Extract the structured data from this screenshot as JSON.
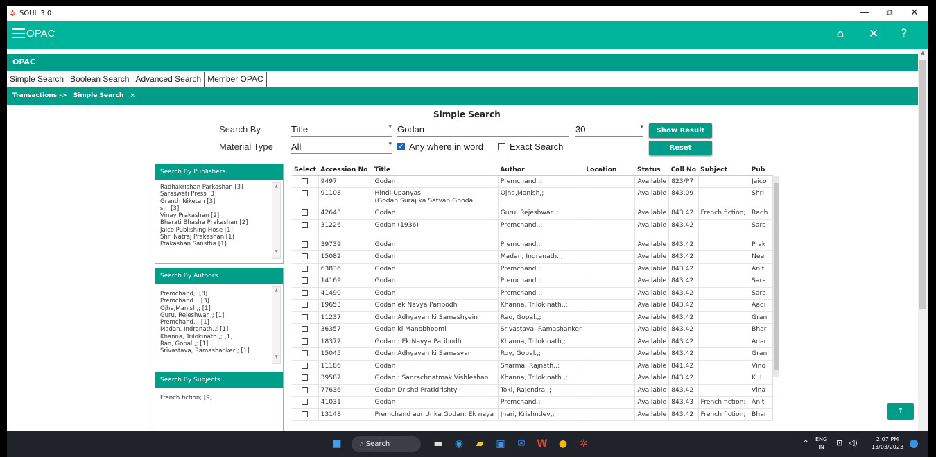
{
  "window": {
    "title": "SOUL 3.0",
    "controls": [
      "—",
      "⧉",
      "✕"
    ]
  },
  "header": {
    "app_name": "OPAC"
  },
  "opac_bar": "OPAC",
  "tabs": [
    "Simple Search",
    "Boolean Search",
    "Advanced Search",
    "Member OPAC"
  ],
  "breadcrumb": {
    "parent": "Transactions ->",
    "current": "Simple Search",
    "close": "×"
  },
  "form": {
    "title": "Simple Search",
    "search_by_label": "Search By",
    "search_by_value": "Title",
    "query": "Godan",
    "page_size": "30",
    "material_type_label": "Material Type",
    "material_type_value": "All",
    "anywhere_label": "Any where in word",
    "anywhere_checked": true,
    "exact_label": "Exact Search",
    "exact_checked": false,
    "show_result": "Show Result",
    "reset": "Reset"
  },
  "panels": {
    "publishers": {
      "title": "Search By Publishers",
      "items": [
        "Radhakrishan Parkashan [3]",
        "Saraswati Press [3]",
        "Granth Niketan [3]",
        "s.n [3]",
        "Vinay Prakashan [2]",
        "Bharati Bhasha Prakashan [2]",
        "Jaico Publishing Hose [1]",
        "Shri Natraj Prakashan [1]",
        "Prakashan Sanstha [1]"
      ]
    },
    "authors": {
      "title": "Search By Authors",
      "items": [
        "Premchand,; [8]",
        "Premchand ,; [3]",
        "Ojha,Manish,; [1]",
        "Guru, Rejeshwar.,; [1]",
        "Premchand.,; [1]",
        "Madan, Indranath.,; [1]",
        "Khanna, Trilokinath.,; [1]",
        "Rao, Gopal.,; [1]",
        "Srivastava, Ramashanker ; [1]"
      ]
    },
    "subjects": {
      "title": "Search By Subjects",
      "items": [
        "French fiction; [9]"
      ]
    }
  },
  "table": {
    "headers": [
      "Select",
      "Accession No",
      "Title",
      "Author",
      "Location",
      "Status",
      "Call No",
      "Subject",
      "Pub"
    ],
    "rows": [
      {
        "acc": "9497",
        "title": "Godan",
        "title2": "",
        "author": "Premchand ,;",
        "location": "",
        "status": "Available",
        "call": "823/P7",
        "subject": "",
        "pub": "Jaico"
      },
      {
        "acc": "91108",
        "title": "Hindi Upanyas",
        "title2": "(Godan Suraj ka Satvan Ghoda",
        "author": "Ojha,Manish,;",
        "location": "",
        "status": "Available",
        "call": "843.09",
        "subject": "",
        "pub": "Shri"
      },
      {
        "acc": "42643",
        "title": "Godan",
        "title2": "",
        "author": "Guru, Rejeshwar.,;",
        "location": "",
        "status": "Available",
        "call": "843.42",
        "subject": "French fiction;",
        "pub": "Radh"
      },
      {
        "acc": "31226",
        "title": "Godan (1936)",
        "title2": " ",
        "author": "Premchand.,;",
        "location": "",
        "status": "Available",
        "call": "843.42",
        "subject": "",
        "pub": "Sara"
      },
      {
        "acc": "39739",
        "title": "Godan",
        "title2": "",
        "author": "Premchand,;",
        "location": "",
        "status": "Available",
        "call": "843.42",
        "subject": "",
        "pub": "Prak"
      },
      {
        "acc": "15082",
        "title": "Godan",
        "title2": "",
        "author": "Madan, Indranath.,;",
        "location": "",
        "status": "Available",
        "call": "843.42",
        "subject": "",
        "pub": "Neel"
      },
      {
        "acc": "63836",
        "title": "Godan",
        "title2": "",
        "author": "Premchand,;",
        "location": "",
        "status": "Available",
        "call": "843.42",
        "subject": "",
        "pub": "Anit"
      },
      {
        "acc": "14169",
        "title": "Godan",
        "title2": "",
        "author": "Premchand,;",
        "location": "",
        "status": "Available",
        "call": "843.42",
        "subject": "",
        "pub": "Sara"
      },
      {
        "acc": "41490",
        "title": "Godan",
        "title2": "",
        "author": "Premchand ,;",
        "location": "",
        "status": "Available",
        "call": "843.42",
        "subject": "",
        "pub": "Sara"
      },
      {
        "acc": "19653",
        "title": "Godan ek Navya Paribodh",
        "title2": "",
        "author": "Khanna, Trilokinath.,;",
        "location": "",
        "status": "Available",
        "call": "843.42",
        "subject": "",
        "pub": "Aadi"
      },
      {
        "acc": "11237",
        "title": "Godan Adhyayan ki Samashyein",
        "title2": "",
        "author": "Rao, Gopal.,;",
        "location": "",
        "status": "Available",
        "call": "843.42",
        "subject": "",
        "pub": "Gran"
      },
      {
        "acc": "36357",
        "title": "Godan ki Manobhoomi",
        "title2": "",
        "author": "Srivastava, Ramashanker",
        "location": "",
        "status": "Available",
        "call": "843.42",
        "subject": "",
        "pub": "Bhar"
      },
      {
        "acc": "18372",
        "title": "Godan : Ek Navya Paribodh",
        "title2": "",
        "author": "Khanna, Trilokinath,;",
        "location": "",
        "status": "Available",
        "call": "843.42",
        "subject": "",
        "pub": "Adar"
      },
      {
        "acc": "15045",
        "title": "Godan Adhyayan ki Samasyan",
        "title2": "",
        "author": "Roy, Gopal.,;",
        "location": "",
        "status": "Available",
        "call": "843.42",
        "subject": "",
        "pub": "Gran"
      },
      {
        "acc": "11186",
        "title": "Godan",
        "title2": "",
        "author": "Sharma, Rajnath.,;",
        "location": "",
        "status": "Available",
        "call": "841.42",
        "subject": "",
        "pub": "Vino"
      },
      {
        "acc": "39587",
        "title": "Godan : Sanrachnatmak Vishleshan",
        "title2": "",
        "author": "Khanna, Trilokinath ,;",
        "location": "",
        "status": "Available",
        "call": "843.42",
        "subject": "",
        "pub": "K. L"
      },
      {
        "acc": "77636",
        "title": "Godan Drishti Pratidrishtyi",
        "title2": "",
        "author": "Toki, Rajendra.,;",
        "location": "",
        "status": "Available",
        "call": "843.42",
        "subject": "",
        "pub": "Vina"
      },
      {
        "acc": "41031",
        "title": "Godan",
        "title2": "",
        "author": "Premchand,;",
        "location": "",
        "status": "Available",
        "call": "843.43",
        "subject": "French fiction;",
        "pub": "Anit"
      },
      {
        "acc": "13148",
        "title": "Premchand aur Unka Godan: Ek naya",
        "title2": "",
        "author": "Jhari, Krishndev,;",
        "location": "",
        "status": "Available",
        "call": "843.42",
        "subject": "French fiction;",
        "pub": "Bhar"
      }
    ]
  },
  "scroll_top_label": "↑",
  "taskbar": {
    "search_label": "Search",
    "lang": "ENG",
    "region": "IN",
    "time": "2:07 PM",
    "date": "13/03/2023"
  }
}
